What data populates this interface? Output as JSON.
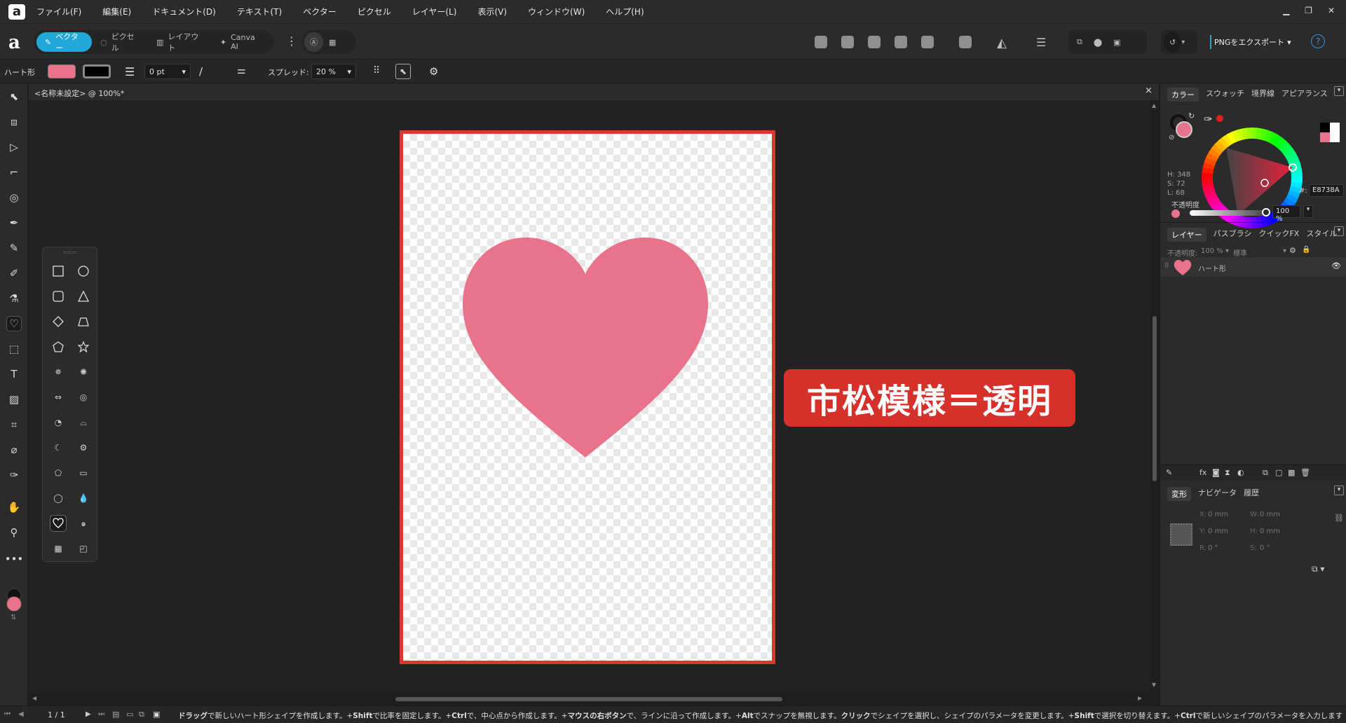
{
  "app": {
    "logo": "a"
  },
  "menu": [
    "ファイル(F)",
    "編集(E)",
    "ドキュメント(D)",
    "テキスト(T)",
    "ベクター",
    "ピクセル",
    "レイヤー(L)",
    "表示(V)",
    "ウィンドウ(W)",
    "ヘルプ(H)"
  ],
  "toolbar": {
    "modes": [
      "ベクター",
      "ピクセル",
      "レイアウト",
      "Canva AI"
    ],
    "export_label": "PNGをエクスポート",
    "help": "?"
  },
  "context": {
    "shape_name": "ハート形",
    "fill_color": "#E8738A",
    "stroke_color": "#000000",
    "stroke_width": "0 pt",
    "spread_label": "スプレッド:",
    "spread_value": "20 %"
  },
  "document": {
    "tab_title": "<名称未設定> @ 100%*",
    "close": "×"
  },
  "callout": {
    "text": "市松模様＝透明",
    "color": "#D5302A"
  },
  "color_panel": {
    "tabs": [
      "カラー",
      "スウォッチ",
      "境界線",
      "アピアランス"
    ],
    "h": "H: 348",
    "s": "S: 72",
    "l": "L: 68",
    "hex_prefix": "#:",
    "hex": "E8738A",
    "opacity_label": "不透明度",
    "opacity_value": "100 %"
  },
  "layers_panel": {
    "tabs": [
      "レイヤー",
      "パスブラシ",
      "クイックFX",
      "スタイル"
    ],
    "opacity_label": "不透明度:",
    "opacity_value": "100 %",
    "blend_mode": "標準",
    "layer_name": "ハート形"
  },
  "transform_panel": {
    "tabs": [
      "変形",
      "ナビゲータ",
      "履歴"
    ],
    "x_label": "X:",
    "x": "0 mm",
    "w_label": "W:",
    "w": "0 mm",
    "y_label": "Y:",
    "y": "0 mm",
    "h_label": "H:",
    "h": "0 mm",
    "r_label": "R:",
    "r": "0 °",
    "s_label": "S:",
    "s": "0 °"
  },
  "status": {
    "page": "1 / 1",
    "hint_parts": [
      {
        "b": "ドラッグ",
        "t": "で新しいハート形シェイプを作成します。+"
      },
      {
        "b": "Shift",
        "t": "で比率を固定します。+"
      },
      {
        "b": "Ctrl",
        "t": "で、中心点から作成します。+"
      },
      {
        "b": "マウスの右ボタン",
        "t": "で、ラインに沿って作成します。+"
      },
      {
        "b": "Alt",
        "t": "でスナップを無視します。"
      },
      {
        "b": "クリック",
        "t": "でシェイプを選択し、シェイプのパラメータを変更します。+"
      },
      {
        "b": "Shift",
        "t": "で選択を切り替えます。+"
      },
      {
        "b": "Ctrl",
        "t": "で新しいシェイプのパラメータを入力します"
      }
    ]
  },
  "icons": {
    "heart_color": "#E8738A",
    "accent": "#21A8D8",
    "page_border": "#D93A30"
  }
}
